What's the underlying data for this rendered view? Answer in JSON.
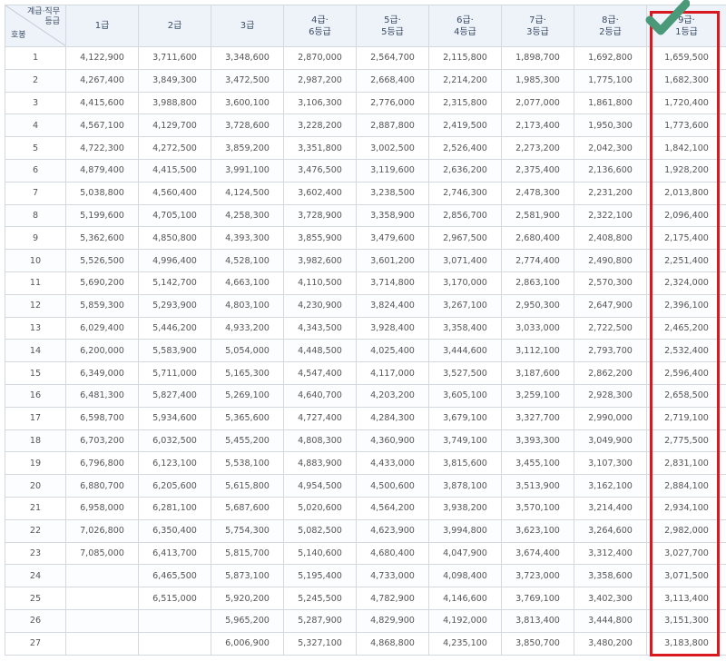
{
  "header": {
    "corner_top": "계급·직무\n등급",
    "corner_bottom": "호봉",
    "columns": [
      "1급",
      "2급",
      "3급",
      "4급·\n6등급",
      "5급·\n5등급",
      "6급·\n4등급",
      "7급·\n3등급",
      "8급·\n2등급",
      "9급·\n1등급"
    ]
  },
  "highlight": {
    "color": "#d8191f",
    "checkmark_color": "#4a9a7a",
    "column": "9급·1등급"
  },
  "rows": [
    [
      "1",
      "4,122,900",
      "3,711,600",
      "3,348,600",
      "2,870,000",
      "2,564,700",
      "2,115,800",
      "1,898,700",
      "1,692,800",
      "1,659,500"
    ],
    [
      "2",
      "4,267,400",
      "3,849,300",
      "3,472,500",
      "2,987,200",
      "2,668,400",
      "2,214,200",
      "1,985,300",
      "1,775,100",
      "1,682,300"
    ],
    [
      "3",
      "4,415,600",
      "3,988,800",
      "3,600,100",
      "3,106,300",
      "2,776,000",
      "2,315,800",
      "2,077,000",
      "1,861,800",
      "1,720,400"
    ],
    [
      "4",
      "4,567,100",
      "4,129,700",
      "3,728,600",
      "3,228,200",
      "2,887,800",
      "2,419,500",
      "2,173,400",
      "1,950,300",
      "1,773,600"
    ],
    [
      "5",
      "4,722,300",
      "4,272,500",
      "3,859,200",
      "3,351,800",
      "3,002,500",
      "2,526,400",
      "2,273,200",
      "2,042,300",
      "1,842,100"
    ],
    [
      "6",
      "4,879,400",
      "4,415,500",
      "3,991,100",
      "3,476,500",
      "3,119,600",
      "2,636,200",
      "2,375,400",
      "2,136,600",
      "1,928,200"
    ],
    [
      "7",
      "5,038,800",
      "4,560,400",
      "4,124,500",
      "3,602,400",
      "3,238,500",
      "2,746,300",
      "2,478,300",
      "2,231,200",
      "2,013,800"
    ],
    [
      "8",
      "5,199,600",
      "4,705,100",
      "4,258,300",
      "3,728,900",
      "3,358,900",
      "2,856,700",
      "2,581,900",
      "2,322,100",
      "2,096,400"
    ],
    [
      "9",
      "5,362,600",
      "4,850,800",
      "4,393,300",
      "3,855,900",
      "3,479,600",
      "2,967,500",
      "2,680,400",
      "2,408,800",
      "2,175,400"
    ],
    [
      "10",
      "5,526,500",
      "4,996,400",
      "4,528,100",
      "3,982,600",
      "3,601,200",
      "3,071,400",
      "2,774,400",
      "2,490,800",
      "2,251,400"
    ],
    [
      "11",
      "5,690,200",
      "5,142,700",
      "4,663,100",
      "4,110,500",
      "3,714,800",
      "3,170,000",
      "2,863,100",
      "2,570,300",
      "2,324,000"
    ],
    [
      "12",
      "5,859,300",
      "5,293,900",
      "4,803,100",
      "4,230,900",
      "3,824,400",
      "3,267,100",
      "2,950,300",
      "2,647,900",
      "2,396,100"
    ],
    [
      "13",
      "6,029,400",
      "5,446,200",
      "4,933,200",
      "4,343,500",
      "3,928,400",
      "3,358,400",
      "3,033,000",
      "2,722,500",
      "2,465,200"
    ],
    [
      "14",
      "6,200,000",
      "5,583,900",
      "5,054,000",
      "4,448,500",
      "4,025,400",
      "3,444,600",
      "3,112,100",
      "2,793,700",
      "2,532,400"
    ],
    [
      "15",
      "6,349,000",
      "5,711,000",
      "5,165,300",
      "4,547,400",
      "4,117,000",
      "3,527,500",
      "3,187,600",
      "2,862,200",
      "2,596,400"
    ],
    [
      "16",
      "6,481,300",
      "5,827,400",
      "5,269,100",
      "4,640,700",
      "4,203,200",
      "3,605,100",
      "3,259,100",
      "2,928,300",
      "2,658,500"
    ],
    [
      "17",
      "6,598,700",
      "5,934,600",
      "5,365,600",
      "4,727,400",
      "4,284,300",
      "3,679,100",
      "3,327,700",
      "2,990,000",
      "2,719,100"
    ],
    [
      "18",
      "6,703,200",
      "6,032,500",
      "5,455,200",
      "4,808,300",
      "4,360,900",
      "3,749,100",
      "3,393,300",
      "3,049,900",
      "2,775,500"
    ],
    [
      "19",
      "6,796,800",
      "6,123,100",
      "5,538,100",
      "4,883,900",
      "4,433,000",
      "3,815,600",
      "3,455,100",
      "3,107,300",
      "2,831,100"
    ],
    [
      "20",
      "6,880,700",
      "6,205,600",
      "5,615,800",
      "4,954,500",
      "4,500,600",
      "3,878,100",
      "3,513,900",
      "3,162,100",
      "2,884,100"
    ],
    [
      "21",
      "6,958,000",
      "6,281,100",
      "5,687,600",
      "5,020,600",
      "4,564,200",
      "3,938,200",
      "3,570,100",
      "3,214,400",
      "2,934,100"
    ],
    [
      "22",
      "7,026,800",
      "6,350,400",
      "5,754,300",
      "5,082,500",
      "4,623,900",
      "3,994,800",
      "3,623,100",
      "3,264,600",
      "2,982,000"
    ],
    [
      "23",
      "7,085,000",
      "6,413,700",
      "5,815,700",
      "5,140,600",
      "4,680,400",
      "4,047,900",
      "3,674,400",
      "3,312,400",
      "3,027,700"
    ],
    [
      "24",
      "",
      "6,465,500",
      "5,873,100",
      "5,195,400",
      "4,733,000",
      "4,098,400",
      "3,723,000",
      "3,358,600",
      "3,071,500"
    ],
    [
      "25",
      "",
      "6,515,000",
      "5,920,200",
      "5,245,500",
      "4,782,900",
      "4,146,600",
      "3,769,100",
      "3,402,300",
      "3,113,400"
    ],
    [
      "26",
      "",
      "",
      "5,965,200",
      "5,287,900",
      "4,829,900",
      "4,192,000",
      "3,813,400",
      "3,444,800",
      "3,151,300"
    ],
    [
      "27",
      "",
      "",
      "6,006,900",
      "5,327,100",
      "4,868,800",
      "4,235,100",
      "3,850,700",
      "3,480,200",
      "3,183,800"
    ]
  ]
}
